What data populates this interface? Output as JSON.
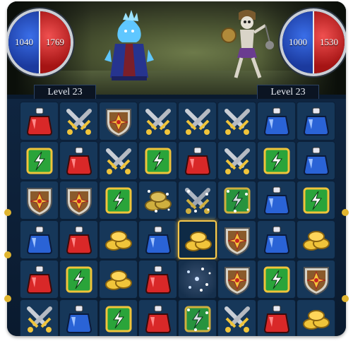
{
  "player": {
    "mana": "1040",
    "health": "1769",
    "level_label": "Level 23"
  },
  "enemy": {
    "mana": "1000",
    "health": "1530",
    "level_label": "Level 23"
  },
  "board": {
    "rows": [
      [
        "red-potion",
        "sword",
        "shield",
        "sword",
        "sword",
        "sword",
        "blue-potion",
        "blue-potion"
      ],
      [
        "green-rune",
        "red-potion",
        "sword",
        "green-rune",
        "red-potion",
        "sword",
        "green-rune",
        "blue-potion"
      ],
      [
        "shield",
        "shield",
        "green-rune",
        "gold-coins-burst",
        "sword-burst",
        "green-rune-burst",
        "blue-potion",
        "green-rune"
      ],
      [
        "blue-potion",
        "red-potion",
        "gold-coins",
        "blue-potion",
        "gold-coins",
        "shield",
        "blue-potion",
        "gold-coins"
      ],
      [
        "red-potion",
        "green-rune",
        "gold-coins",
        "red-potion",
        "sparkle",
        "shield",
        "green-rune",
        "shield"
      ],
      [
        "sword",
        "blue-potion",
        "green-rune",
        "red-potion",
        "green-rune-burst",
        "sword",
        "red-potion",
        "gold-coins"
      ]
    ],
    "selected": {
      "row": 3,
      "col": 4
    }
  },
  "colors": {
    "potion_red": "#d92828",
    "potion_blue": "#2a63d6",
    "rune_green": "#2aa43a",
    "shield_brown": "#8a5a2b",
    "gold": "#f0c43a",
    "selected_border": "#f3c64b"
  }
}
